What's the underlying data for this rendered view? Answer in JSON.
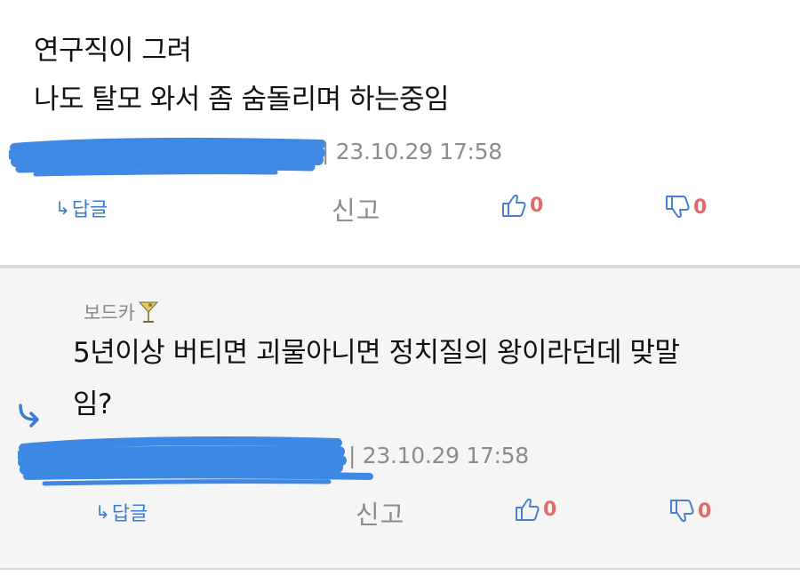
{
  "comments": [
    {
      "lines": [
        "연구직이 그려",
        "나도 탈모 와서 좀 숨돌리며 하는중임"
      ],
      "meta": "| 23.10.29 17:58",
      "reply_label": "답글",
      "report_label": "신고",
      "likes": "0",
      "dislikes": "0"
    },
    {
      "nickname": "보드카",
      "lines": [
        "5년이상 버티면 괴물아니면 정치질의 왕이라던데 맞말",
        "임?"
      ],
      "meta": "| 23.10.29 17:58",
      "reply_label": "답글",
      "report_label": "신고",
      "likes": "0",
      "dislikes": "0"
    }
  ],
  "colors": {
    "scribble": "#2a7de1",
    "link": "#3a7bd5",
    "count": "#e26a6a",
    "muted": "#8c8c8c",
    "reply_bg": "#f5f5f5"
  },
  "icons": {
    "reply_link": "reply-arrow-icon",
    "like": "thumbs-up-icon",
    "dislike": "thumbs-down-icon",
    "reply_indicator": "curved-reply-arrow-icon",
    "nickname_badge": "cocktail-glass-icon"
  }
}
